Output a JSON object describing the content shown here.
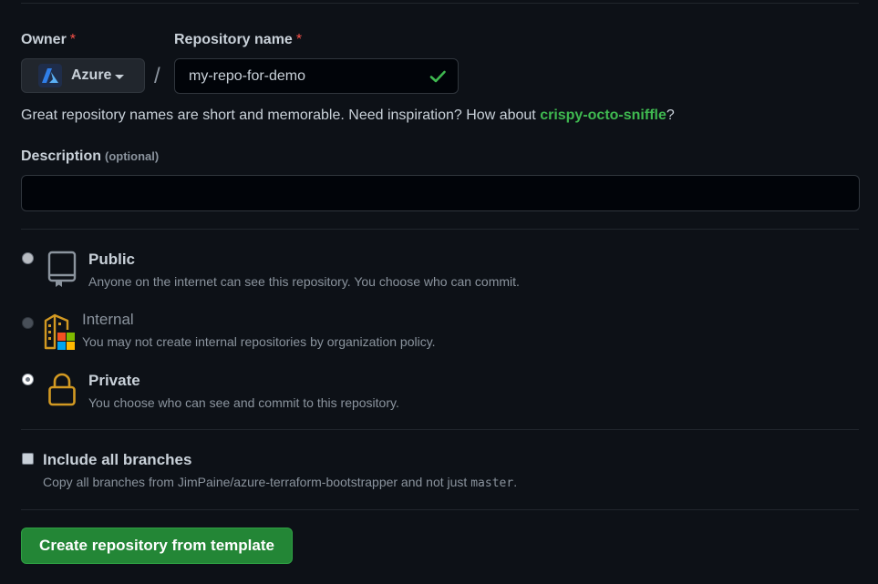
{
  "owner": {
    "label": "Owner",
    "required_mark": "*",
    "value": "Azure",
    "avatar_icon": "azure-logo"
  },
  "repo": {
    "label": "Repository name",
    "required_mark": "*",
    "separator": "/",
    "value": "my-repo-for-demo",
    "status_icon": "check-icon"
  },
  "hint": {
    "prefix": "Great repository names are short and memorable. Need inspiration? How about ",
    "suggestion": "crispy-octo-sniffle",
    "suffix": "?"
  },
  "description": {
    "label": "Description",
    "optional": "(optional)",
    "value": ""
  },
  "visibility": {
    "selected": "private",
    "options": [
      {
        "id": "public",
        "title": "Public",
        "desc": "Anyone on the internet can see this repository. You choose who can commit.",
        "icon": "repo-icon",
        "enabled": true
      },
      {
        "id": "internal",
        "title": "Internal",
        "desc": "You may not create internal repositories by organization policy.",
        "icon": "organization-icon",
        "enabled": false
      },
      {
        "id": "private",
        "title": "Private",
        "desc": "You choose who can see and commit to this repository.",
        "icon": "lock-icon",
        "enabled": true
      }
    ]
  },
  "branches": {
    "label": "Include all branches",
    "checked": false,
    "desc_prefix": "Copy all branches from JimPaine/azure-terraform-bootstrapper and not just ",
    "desc_code": "master",
    "desc_suffix": "."
  },
  "submit": {
    "label": "Create repository from template"
  },
  "colors": {
    "background": "#0d1117",
    "accent_green": "#238636",
    "suggestion_green": "#3fb950",
    "required_red": "#f85149",
    "lock_yellow": "#d29922"
  }
}
